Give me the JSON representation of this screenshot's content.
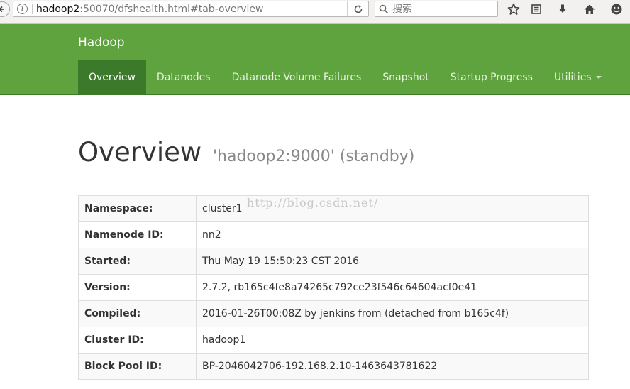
{
  "browser": {
    "url_host": "hadoop2",
    "url_rest": ":50070/dfshealth.html#tab-overview",
    "search_placeholder": "搜索",
    "icons": [
      "back-icon",
      "info-icon",
      "reload-icon",
      "search-icon",
      "bookmark-star-icon",
      "reading-list-icon",
      "download-icon",
      "home-icon",
      "smiley-icon"
    ]
  },
  "navbar": {
    "brand": "Hadoop",
    "items": [
      {
        "label": "Overview"
      },
      {
        "label": "Datanodes"
      },
      {
        "label": "Datanode Volume Failures"
      },
      {
        "label": "Snapshot"
      },
      {
        "label": "Startup Progress"
      },
      {
        "label": "Utilities"
      }
    ],
    "active": "Overview",
    "color": "#5fa33e",
    "active_color": "#3b7a2a"
  },
  "page": {
    "title": "Overview",
    "subtitle": "'hadoop2:9000' (standby)"
  },
  "table": {
    "rows": [
      {
        "key": "Namespace:",
        "value": "cluster1"
      },
      {
        "key": "Namenode ID:",
        "value": "nn2"
      },
      {
        "key": "Started:",
        "value": "Thu May 19 15:50:23 CST 2016"
      },
      {
        "key": "Version:",
        "value": "2.7.2, rb165c4fe8a74265c792ce23f546c64604acf0e41"
      },
      {
        "key": "Compiled:",
        "value": "2016-01-26T00:08Z by jenkins from (detached from b165c4f)"
      },
      {
        "key": "Cluster ID:",
        "value": "hadoop1"
      },
      {
        "key": "Block Pool ID:",
        "value": "BP-2046042706-192.168.2.10-1463643781622"
      }
    ]
  },
  "watermark": "http://blog.csdn.net/"
}
